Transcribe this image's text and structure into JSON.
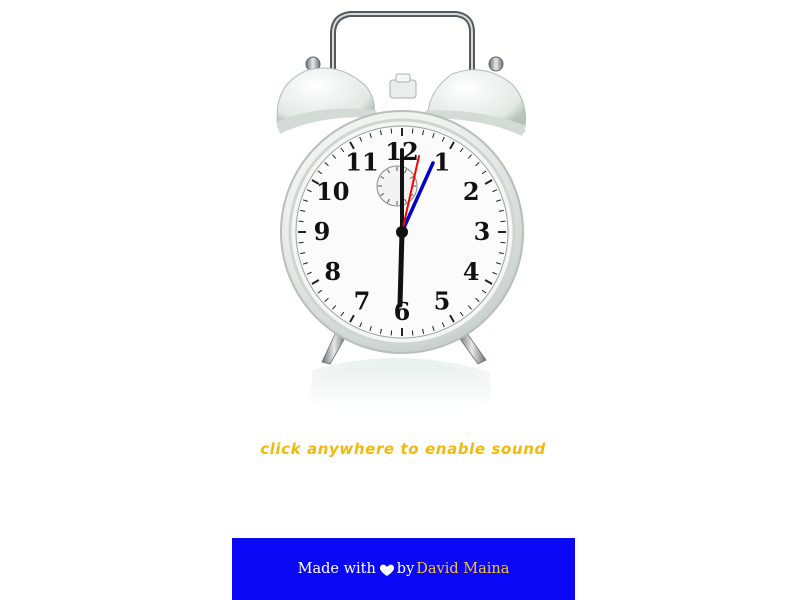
{
  "hint": {
    "text": "click anywhere to enable sound"
  },
  "footer": {
    "made_with": "Made with",
    "by": "by",
    "author": "David Maina",
    "heart_icon": "heart-icon",
    "background_color": "#0a08f5",
    "author_color": "#f5c53a"
  },
  "clock": {
    "numerals": [
      "12",
      "1",
      "2",
      "3",
      "4",
      "5",
      "6",
      "7",
      "8",
      "9",
      "10",
      "11"
    ],
    "hands": {
      "hour": "12",
      "minute": "6",
      "second_hand_color": "#ff0000",
      "minute_hand_color": "#0000c8"
    }
  }
}
